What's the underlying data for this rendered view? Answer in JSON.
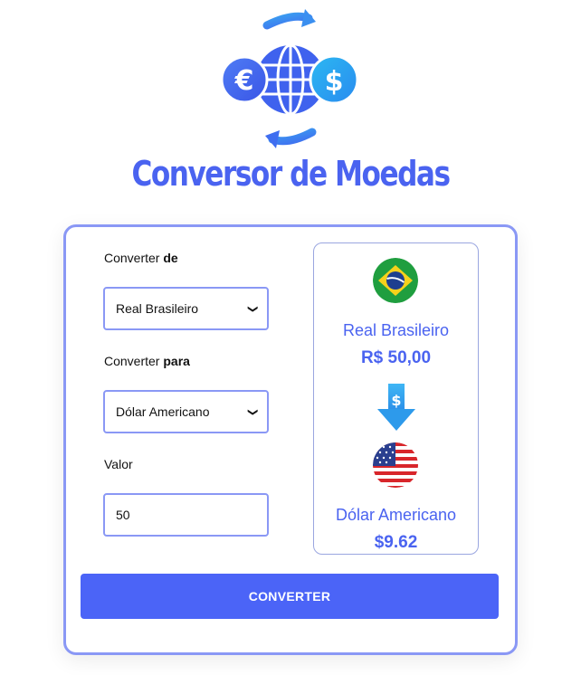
{
  "header": {
    "title": "Conversor de Moedas"
  },
  "form": {
    "from_label_prefix": "Converter ",
    "from_label_bold": "de",
    "from_value": "Real Brasileiro",
    "to_label_prefix": "Converter ",
    "to_label_bold": "para",
    "to_value": "Dólar Americano",
    "amount_label": "Valor",
    "amount_value": "50",
    "convert_button": "CONVERTER"
  },
  "result": {
    "from_currency_name": "Real Brasileiro",
    "from_amount": "R$ 50,00",
    "to_currency_name": "Dólar Americano",
    "to_amount": "$9.62"
  },
  "colors": {
    "accent": "#4a63f0",
    "border": "#8a98f5",
    "button": "#4b64f7"
  },
  "icons": [
    "currency-exchange-logo-icon",
    "brazil-flag-icon",
    "down-arrow-dollar-icon",
    "usa-flag-icon",
    "chevron-down-icon"
  ]
}
